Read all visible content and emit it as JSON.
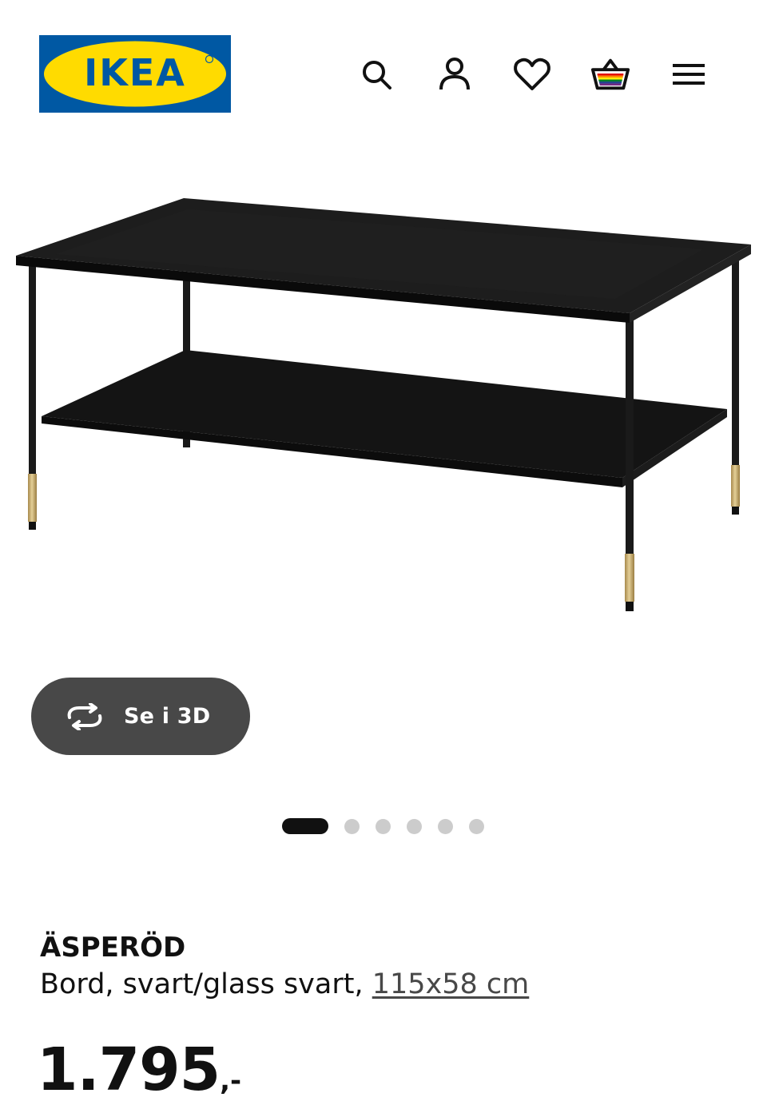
{
  "header": {
    "logo_text": "IKEA",
    "icons": [
      "search-icon",
      "user-icon",
      "heart-icon",
      "basket-icon",
      "menu-icon"
    ]
  },
  "gallery": {
    "view_3d_label": "Se i 3D",
    "slide_count": 6,
    "active_slide": 1
  },
  "product": {
    "name": "ÄSPERÖD",
    "description": "Bord, svart/glass svart,",
    "measurement": "115x58 cm",
    "price_main": "1.795",
    "price_suffix": ",-"
  },
  "colors": {
    "brand_blue": "#0058a3",
    "brand_yellow": "#ffdb00",
    "button_bg": "#484848"
  }
}
